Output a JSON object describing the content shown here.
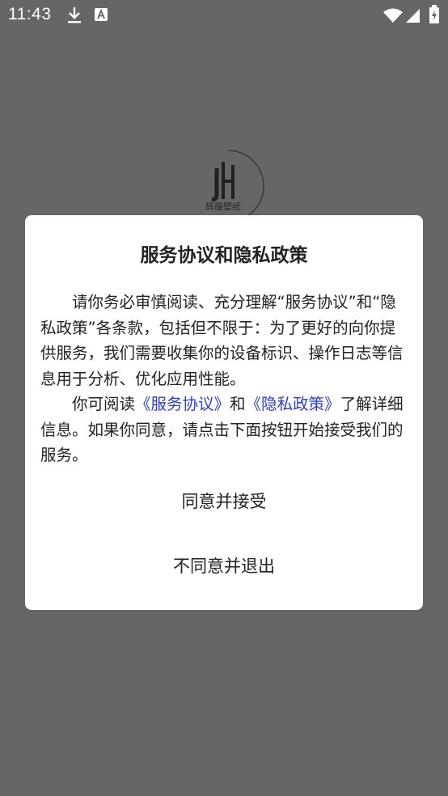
{
  "status_bar": {
    "time": "11:43",
    "left_icons": [
      "download-icon",
      "font-icon"
    ],
    "right_icons": [
      "wifi-icon",
      "signal-icon",
      "battery-icon"
    ]
  },
  "splash": {
    "logo_text": "辉耀壁纸"
  },
  "dialog": {
    "title": "服务协议和隐私政策",
    "paragraph1": "请你务必审慎阅读、充分理解“服务协议”和“隐私政策”各条款，包括但不限于：为了更好的向你提供服务，我们需要收集你的设备标识、操作日志等信息用于分析、优化应用性能。",
    "paragraph2_prefix": "你可阅读",
    "service_agreement_link": "《服务协议》",
    "paragraph2_and": "和",
    "privacy_policy_link": "《隐私政策》",
    "paragraph2_suffix": "了解详细信息。如果你同意，请点击下面按钮开始接受我们的服务。",
    "agree_button": "同意并接受",
    "disagree_button": "不同意并退出",
    "colors": {
      "link": "#2b3bd6",
      "overlay": "#666666",
      "surface": "#ffffff"
    }
  }
}
